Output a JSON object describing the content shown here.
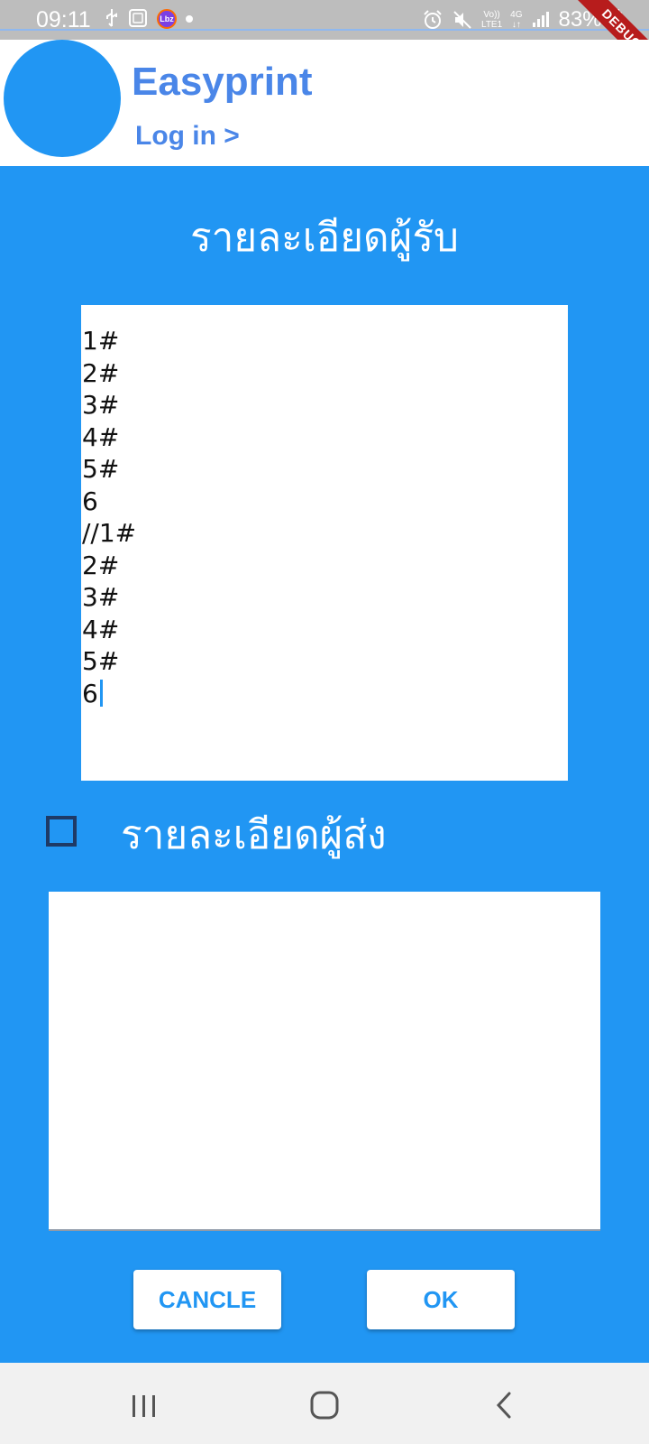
{
  "status_bar": {
    "time": "09:11",
    "battery_text": "83%",
    "network_label_top": "Vo)) ",
    "network_label_bottom": "LTE1",
    "network_type_top": "4G",
    "network_type_bottom": "↓↑",
    "debug_label": "DEBUG",
    "app_badge_text": "Lbz"
  },
  "header": {
    "app_title": "Easyprint",
    "login_label": "Log in >"
  },
  "receiver": {
    "title": "รายละเอียดผู้รับ",
    "lines": [
      "1#",
      "2#",
      "3#",
      "4#",
      "5#",
      "6",
      "//1#",
      "2#",
      "3#",
      "4#",
      "5#",
      "6"
    ]
  },
  "sender": {
    "label": "รายละเอียดผู้ส่ง",
    "checked": false,
    "text": ""
  },
  "buttons": {
    "cancel_label": "CANCLE",
    "ok_label": "OK"
  },
  "colors": {
    "background": "#2196F3",
    "accent_text": "#4a86e8",
    "debug_banner": "#b71c1c"
  },
  "icons": {
    "usb": "usb-icon",
    "alarm": "alarm-icon",
    "mute": "mute-icon",
    "signal": "signal-icon",
    "battery": "battery-charging-icon",
    "recent_apps": "recent-apps-icon",
    "home": "home-icon",
    "back": "back-icon"
  }
}
